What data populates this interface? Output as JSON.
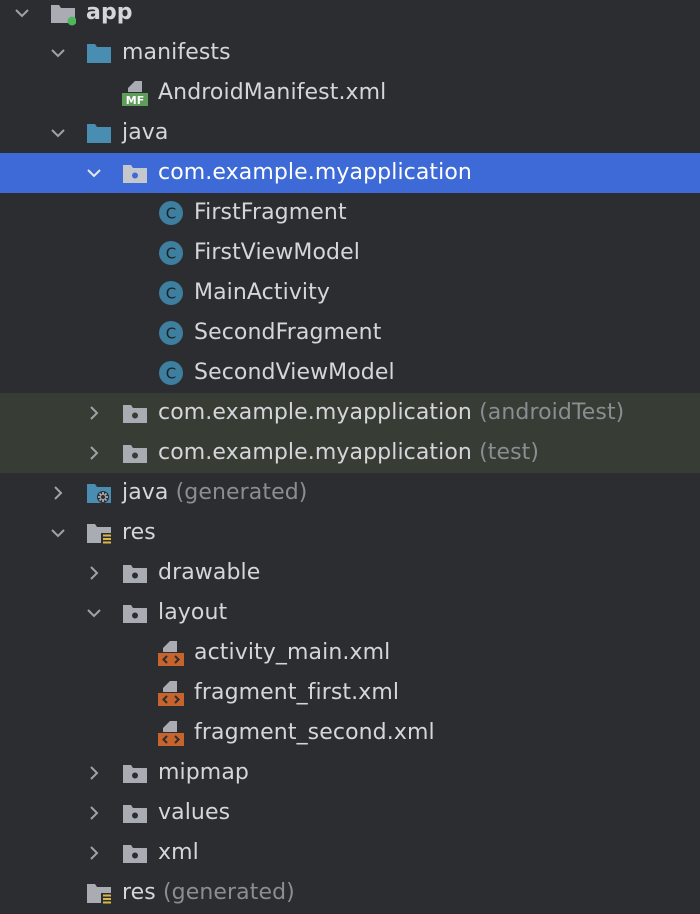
{
  "project_tree": {
    "items": [
      {
        "label": "app",
        "suffix": ""
      },
      {
        "label": "manifests",
        "suffix": ""
      },
      {
        "label": "AndroidManifest.xml",
        "suffix": ""
      },
      {
        "label": "java",
        "suffix": ""
      },
      {
        "label": "com.example.myapplication",
        "suffix": ""
      },
      {
        "label": "FirstFragment",
        "suffix": ""
      },
      {
        "label": "FirstViewModel",
        "suffix": ""
      },
      {
        "label": "MainActivity",
        "suffix": ""
      },
      {
        "label": "SecondFragment",
        "suffix": ""
      },
      {
        "label": "SecondViewModel",
        "suffix": ""
      },
      {
        "label": "com.example.myapplication",
        "suffix": "(androidTest)"
      },
      {
        "label": "com.example.myapplication",
        "suffix": "(test)"
      },
      {
        "label": "java",
        "suffix": "(generated)"
      },
      {
        "label": "res",
        "suffix": ""
      },
      {
        "label": "drawable",
        "suffix": ""
      },
      {
        "label": "layout",
        "suffix": ""
      },
      {
        "label": "activity_main.xml",
        "suffix": ""
      },
      {
        "label": "fragment_first.xml",
        "suffix": ""
      },
      {
        "label": "fragment_second.xml",
        "suffix": ""
      },
      {
        "label": "mipmap",
        "suffix": ""
      },
      {
        "label": "values",
        "suffix": ""
      },
      {
        "label": "xml",
        "suffix": ""
      },
      {
        "label": "res",
        "suffix": "(generated)"
      }
    ],
    "manifest_badge": "MF",
    "class_badge": "C",
    "selected_index": 4
  },
  "colors": {
    "background": "#2b2d30",
    "selection": "#3d6ad6",
    "test_row": "#373c35",
    "folder_blue": "#4a8db3",
    "folder_grey": "#a9adb3",
    "class_icon": "#3e7fa0",
    "layout_icon": "#c7632d",
    "res_badge": "#d8b64a",
    "module_dot": "#4fb65b"
  }
}
